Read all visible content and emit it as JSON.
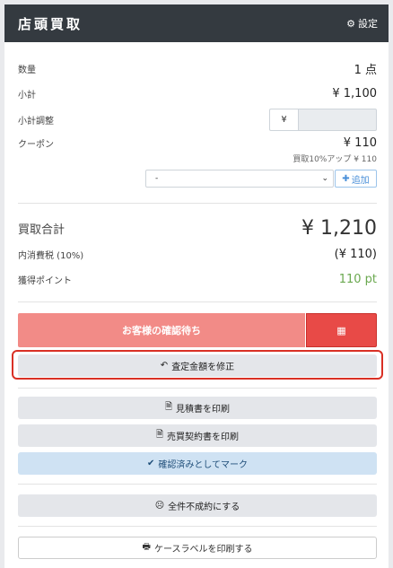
{
  "header": {
    "title": "店頭買取",
    "settings_label": "設定"
  },
  "summary": {
    "quantity_label": "数量",
    "quantity_value": "1 点",
    "subtotal_label": "小計",
    "subtotal_value": "¥ 1,100",
    "adjust_label": "小計調整",
    "adjust_prefix": "¥",
    "adjust_value": "",
    "coupon_label": "クーポン",
    "coupon_value": "¥ 110",
    "coupon_note": "買取10%アップ ¥ 110",
    "coupon_select_value": "-",
    "coupon_add_label": "追加"
  },
  "total": {
    "label": "買取合計",
    "value": "¥ 1,210",
    "tax_label": "内消費税 (10%)",
    "tax_value": "(¥ 110)",
    "points_label": "獲得ポイント",
    "points_value": "110 pt"
  },
  "actions": {
    "wait_label": "お客様の確認待ち",
    "revise_label": "査定金額を修正",
    "estimate_label": "見積書を印刷",
    "contract_label": "売買契約書を印刷",
    "confirmed_label": "確認済みとしてマーク",
    "reject_label": "全件不成約にする",
    "case_label_print": "ケースラベルを印刷する"
  },
  "colors": {
    "header_bg": "#343a40",
    "points_green": "#6aa84f",
    "wait_bg": "#f28b87",
    "qr_bg": "#e84a47",
    "confirm_bg": "#cfe2f3",
    "highlight": "#d93025"
  }
}
